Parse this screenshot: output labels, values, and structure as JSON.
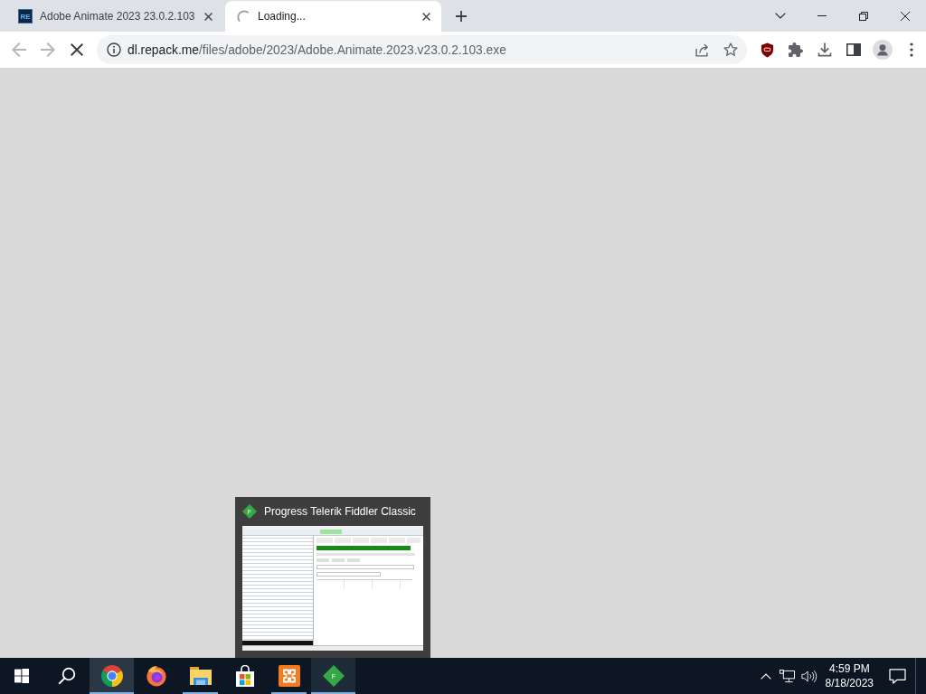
{
  "browser": {
    "tabs": [
      {
        "title": "Adobe Animate 2023 23.0.2.103",
        "favicon_text": "RE",
        "selected": false,
        "loading": false
      },
      {
        "title": "Loading...",
        "selected": true,
        "loading": true
      }
    ],
    "navigation": {
      "back_disabled": true,
      "forward_disabled": true
    },
    "address_bar": {
      "host": "dl.repack.me",
      "path": "/files/adobe/2023/Adobe.Animate.2023.v23.0.2.103.exe"
    }
  },
  "taskbar_preview": {
    "icon_letter": "F",
    "title": "Progress Telerik Fiddler Classic"
  },
  "taskbar": {
    "apps": [
      {
        "kind": "chrome",
        "running": true,
        "active": true,
        "hovered": false
      },
      {
        "kind": "firefox",
        "running": false,
        "active": false,
        "hovered": false
      },
      {
        "kind": "explorer",
        "running": true,
        "active": false,
        "hovered": false
      },
      {
        "kind": "store",
        "running": false,
        "active": false,
        "hovered": false
      },
      {
        "kind": "xampp",
        "running": true,
        "active": false,
        "hovered": false
      },
      {
        "kind": "fiddler",
        "letter": "F",
        "running": true,
        "active": false,
        "hovered": true
      }
    ],
    "clock": {
      "time": "4:59 PM",
      "date": "8/18/2023"
    }
  }
}
